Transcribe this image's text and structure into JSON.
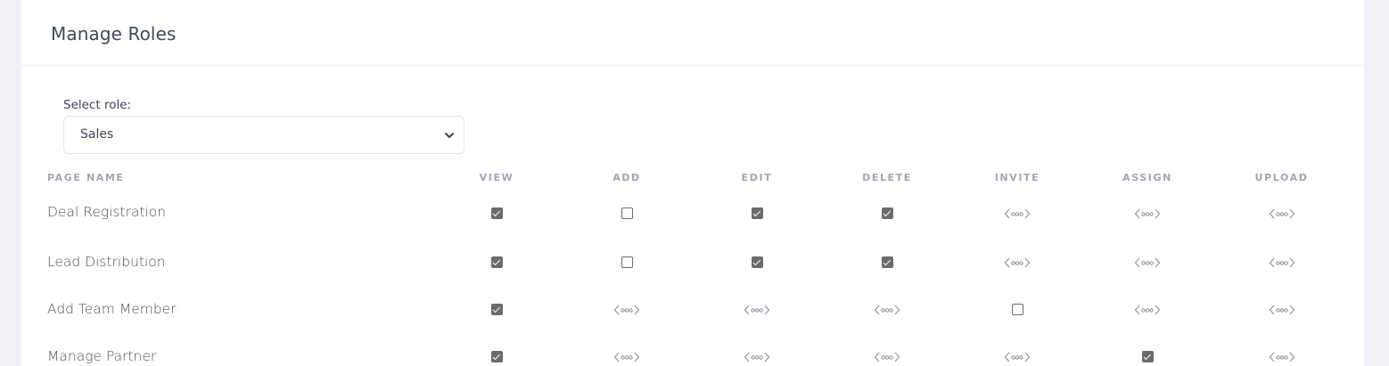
{
  "header": {
    "title": "Manage Roles"
  },
  "role_select": {
    "label": "Select role:",
    "value": "Sales"
  },
  "table": {
    "columns": [
      "PAGE NAME",
      "VIEW",
      "ADD",
      "EDIT",
      "DELETE",
      "INVITE",
      "ASSIGN",
      "UPLOAD"
    ],
    "rows": [
      {
        "name": "Deal Registration",
        "cells": [
          "checked",
          "unchecked",
          "checked",
          "checked",
          "na",
          "na",
          "na"
        ]
      },
      {
        "name": "Lead Distribution",
        "cells": [
          "checked",
          "unchecked",
          "checked",
          "checked",
          "na",
          "na",
          "na"
        ]
      },
      {
        "name": "Add Team Member",
        "cells": [
          "checked",
          "na",
          "na",
          "na",
          "unchecked",
          "na",
          "na"
        ]
      },
      {
        "name": "Manage Partner",
        "cells": [
          "checked",
          "na",
          "na",
          "na",
          "na",
          "checked",
          "na"
        ]
      }
    ]
  },
  "icons": {
    "not_applicable": "code-dots-icon",
    "dropdown": "chevron-down-icon"
  }
}
